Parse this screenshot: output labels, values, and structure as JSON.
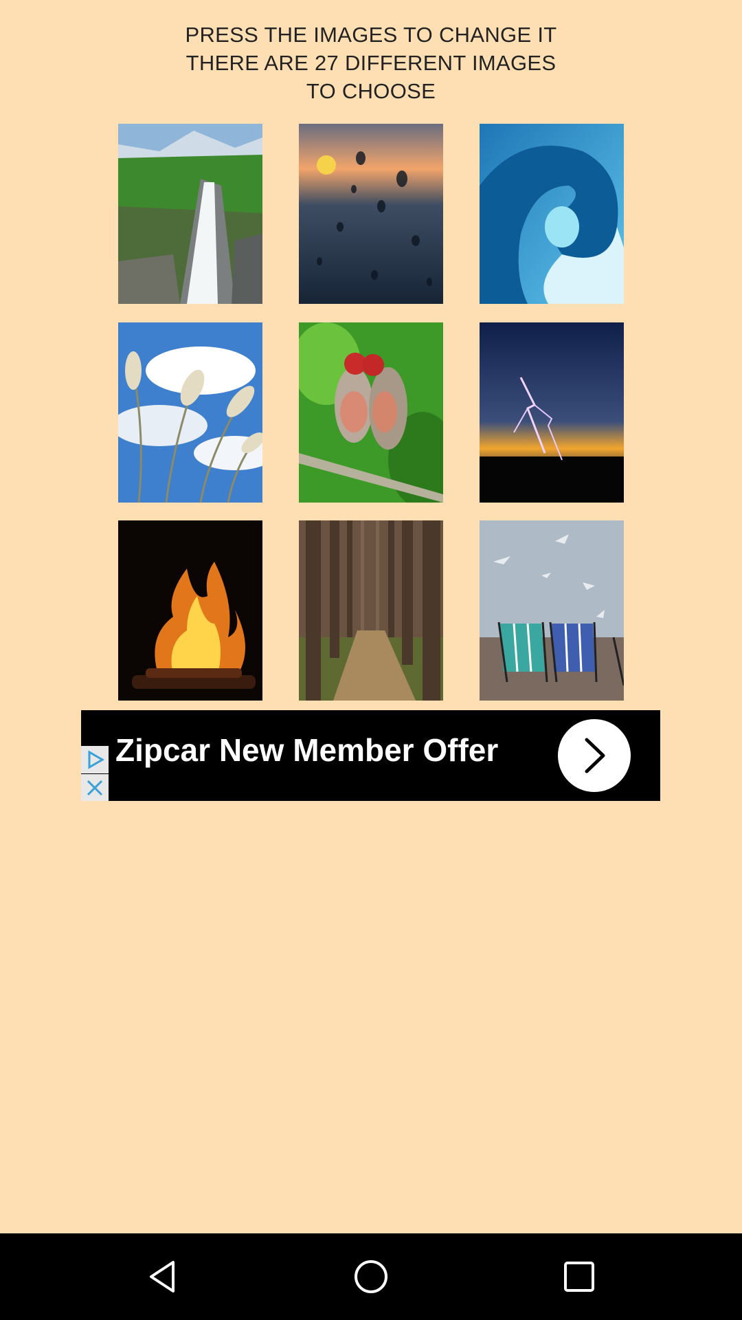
{
  "header": {
    "line1": "PRESS THE IMAGES TO CHANGE IT",
    "line2": "THERE ARE 27 DIFFERENT IMAGES",
    "line3": "TO CHOOSE"
  },
  "ad": {
    "text": "Zipcar New Member Offer",
    "arrow_icon": "chevron-right-icon",
    "adchoices_icon": "adchoices-icon",
    "close_icon": "close-icon"
  },
  "navbar": {
    "back_icon": "back-triangle-icon",
    "home_icon": "home-circle-icon",
    "recents_icon": "recents-square-icon"
  },
  "colors": {
    "background": "#fedfb3",
    "ad_background": "#000000",
    "navbar": "#000000"
  }
}
